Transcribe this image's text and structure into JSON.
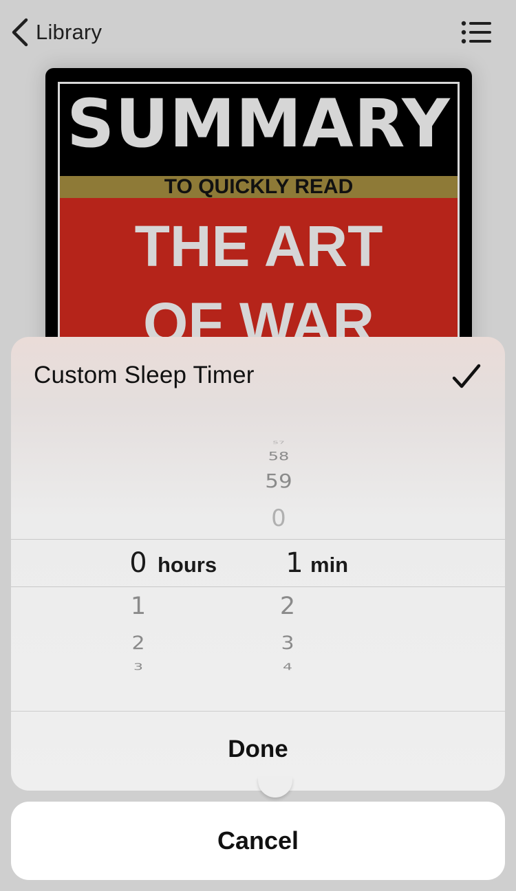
{
  "nav": {
    "back_label": "Library",
    "back_icon": "chevron-left-icon",
    "menu_icon": "list-icon"
  },
  "cover": {
    "title": "SUMMARY",
    "band_text": "TO QUICKLY READ",
    "line1": "THE ART",
    "line2": "OF WAR",
    "colors": {
      "frame": "#000000",
      "band": "#8e7a37",
      "red": "#b5241a",
      "text": "#d6d6d6"
    }
  },
  "sheet": {
    "title": "Custom Sleep Timer",
    "confirm_icon": "checkmark-icon",
    "picker": {
      "hours": {
        "above": [],
        "selected": "0",
        "below": [
          "1",
          "2",
          "3"
        ],
        "unit": "hours"
      },
      "minutes": {
        "above": [
          "57",
          "58",
          "59",
          "0"
        ],
        "selected": "1",
        "below": [
          "2",
          "3",
          "4"
        ],
        "unit": "min"
      }
    },
    "done_label": "Done"
  },
  "cancel_label": "Cancel"
}
